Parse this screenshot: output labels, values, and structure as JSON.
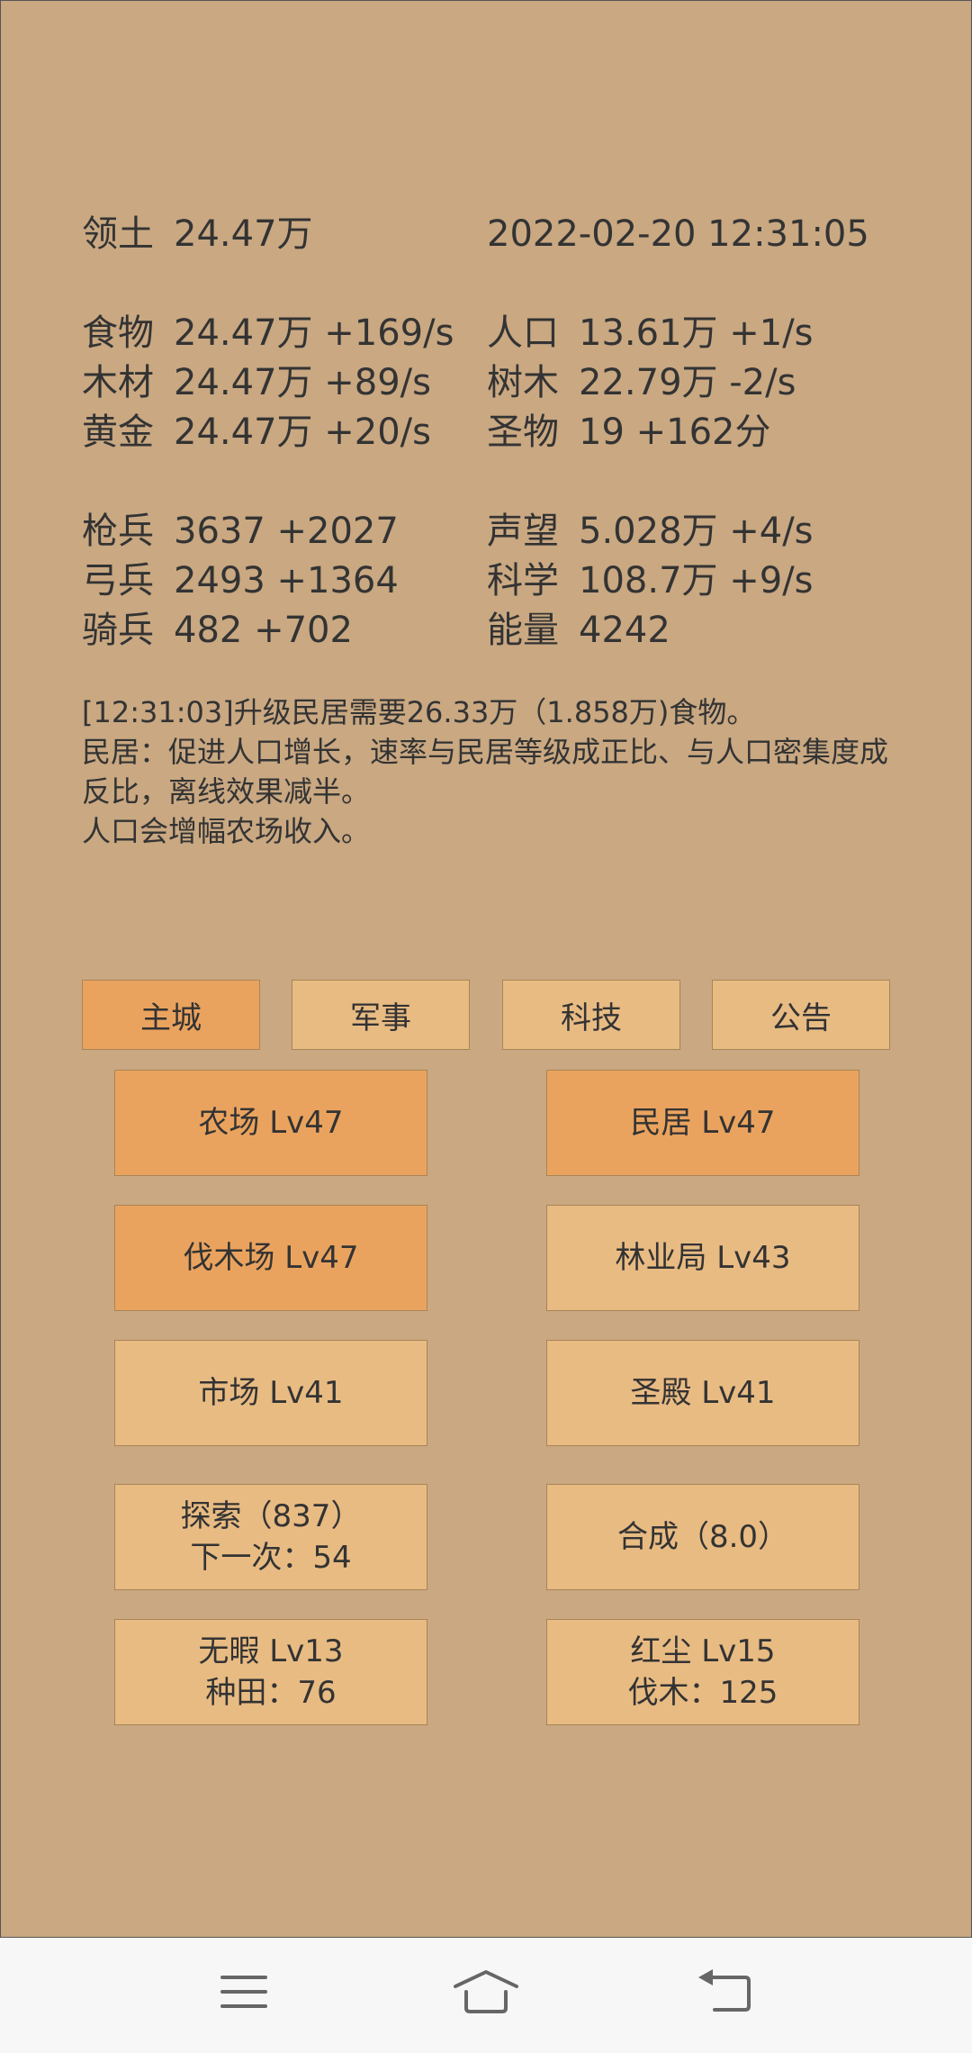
{
  "stats": {
    "territory": {
      "label": "领土",
      "value": "24.47万"
    },
    "datetime": "2022-02-20 12:31:05",
    "resources": [
      {
        "label": "食物",
        "value": "24.47万 +169/s"
      },
      {
        "label": "人口",
        "value": "13.61万 +1/s"
      },
      {
        "label": "木材",
        "value": "24.47万 +89/s"
      },
      {
        "label": "树木",
        "value": "22.79万 -2/s"
      },
      {
        "label": "黄金",
        "value": "24.47万 +20/s"
      },
      {
        "label": "圣物",
        "value": "19 +162分"
      }
    ],
    "military": [
      {
        "label": "枪兵",
        "value": "3637 +2027"
      },
      {
        "label": "声望",
        "value": "5.028万 +4/s"
      },
      {
        "label": "弓兵",
        "value": "2493 +1364"
      },
      {
        "label": "科学",
        "value": "108.7万 +9/s"
      },
      {
        "label": "骑兵",
        "value": "482 +702"
      },
      {
        "label": "能量",
        "value": "4242"
      }
    ]
  },
  "message": {
    "lines": [
      "[12:31:03]升级民居需要26.33万（1.858万)食物。",
      "民居：促进人口增长，速率与民居等级成正比、与人口密集度成",
      "反比，离线效果减半。",
      "人口会增幅农场收入。"
    ]
  },
  "tabs": [
    {
      "label": "主城",
      "active": true
    },
    {
      "label": "军事",
      "active": false
    },
    {
      "label": "科技",
      "active": false
    },
    {
      "label": "公告",
      "active": false
    }
  ],
  "buildings": [
    {
      "line1": "农场 Lv47",
      "line2": ""
    },
    {
      "line1": "民居 Lv47",
      "line2": ""
    },
    {
      "line1": "伐木场 Lv47",
      "line2": ""
    },
    {
      "line1": "林业局 Lv43",
      "line2": ""
    },
    {
      "line1": "市场 Lv41",
      "line2": ""
    },
    {
      "line1": "圣殿 Lv41",
      "line2": ""
    },
    {
      "line1": "探索（837）",
      "line2": "下一次：54"
    },
    {
      "line1": "合成（8.0）",
      "line2": ""
    },
    {
      "line1": "无暇 Lv13",
      "line2": "种田：76"
    },
    {
      "line1": "红尘 Lv15",
      "line2": "伐木：125"
    }
  ],
  "navbar": {
    "icons": [
      "menu-icon",
      "home-icon",
      "back-icon"
    ]
  },
  "colors": {
    "background": "#c9a882",
    "button": "#e8bb83",
    "button_highlight": "#eaa35e",
    "text": "#333333"
  }
}
